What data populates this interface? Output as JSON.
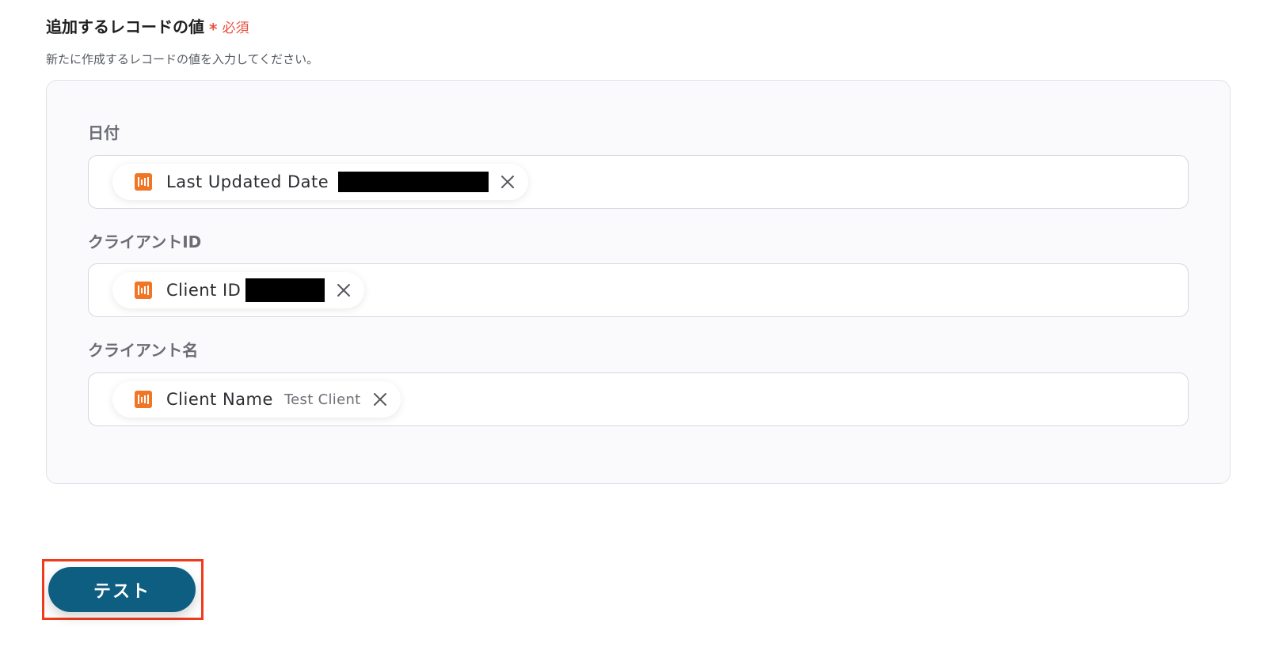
{
  "section": {
    "title": "追加するレコードの値",
    "required_mark": "*",
    "required_label": "必須",
    "description": "新たに作成するレコードの値を入力してください。"
  },
  "fields": [
    {
      "label": "日付",
      "chip": {
        "icon": "app-logo-icon",
        "label": "Last Updated Date",
        "value": "",
        "value_redacted": true
      }
    },
    {
      "label": "クライアントID",
      "chip": {
        "icon": "app-logo-icon",
        "label": "Client ID",
        "value": "",
        "value_redacted": true
      }
    },
    {
      "label": "クライアント名",
      "chip": {
        "icon": "app-logo-icon",
        "label": "Client Name",
        "value": "Test Client",
        "value_redacted": false
      }
    }
  ],
  "actions": {
    "test_label": "テスト"
  },
  "colors": {
    "required": "#e8523f",
    "chip_icon": "#f07625",
    "primary_button": "#0e5e82",
    "highlight": "#ef3b1c"
  }
}
